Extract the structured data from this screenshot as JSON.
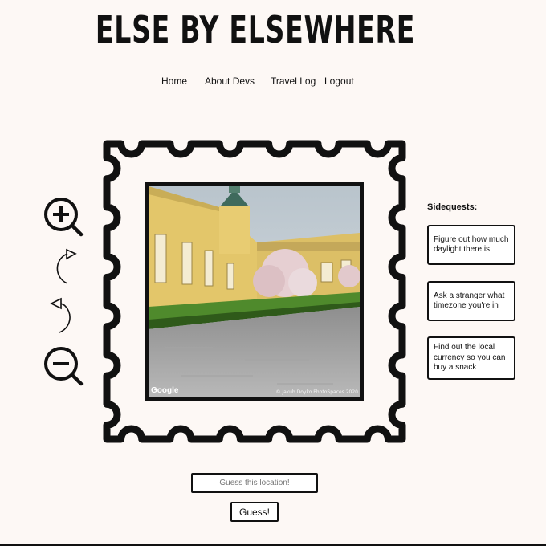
{
  "header": {
    "title": "ELSE BY ELSEWHERE"
  },
  "nav": [
    {
      "label": "Home"
    },
    {
      "label": "About Devs"
    },
    {
      "label": "Travel Log"
    },
    {
      "label": "Logout"
    }
  ],
  "tools": {
    "zoom_in_icon": "zoom-in",
    "rotate_right_icon": "rotate-clockwise",
    "rotate_left_icon": "rotate-counterclockwise",
    "zoom_out_icon": "zoom-out"
  },
  "street_view": {
    "attribution_logo": "Google",
    "photo_credit": "© Jakub Doyko PhotoSpaces 2020"
  },
  "sidequests": {
    "heading": "Sidequests:",
    "items": [
      "Figure out how much daylight there is",
      "Ask a stranger what timezone you're in",
      "Find out the local currency so you can buy a snack"
    ]
  },
  "guess": {
    "placeholder": "Guess this location!",
    "button_label": "Guess!"
  },
  "colors": {
    "background": "#fdf8f5",
    "ink": "#111111",
    "card": "#ffffff"
  }
}
